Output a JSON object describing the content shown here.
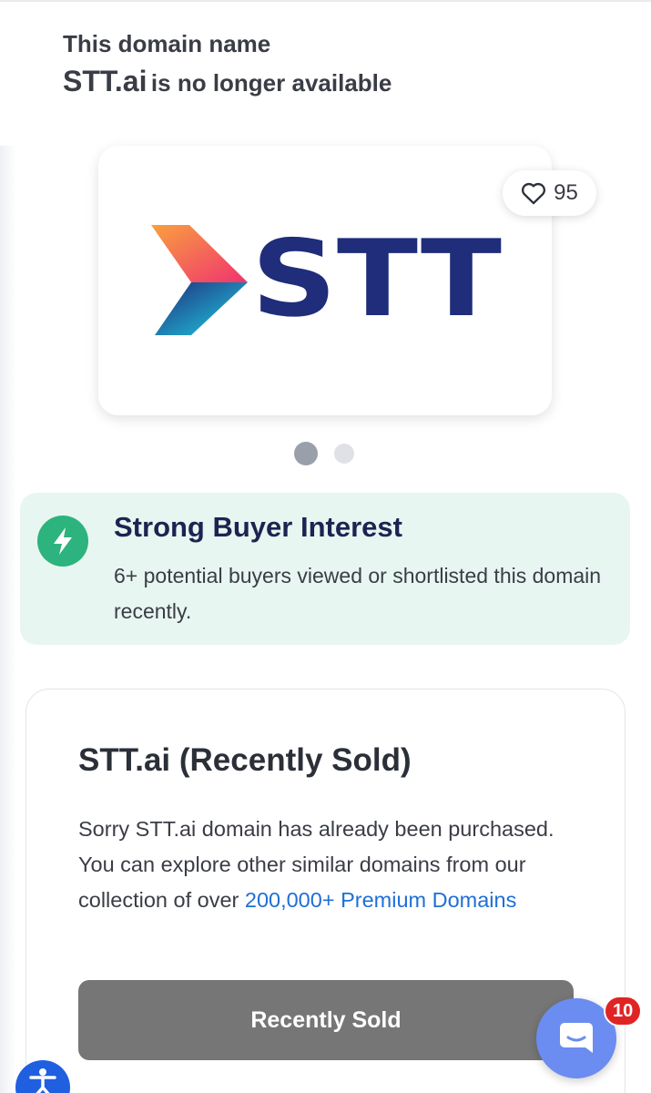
{
  "heading": {
    "line1": "This domain name",
    "domain": "STT.ai",
    "status": "is no longer available"
  },
  "logo": {
    "text": "STT"
  },
  "favorite": {
    "icon": "heart-outline-icon",
    "count": "95"
  },
  "carousel": {
    "total": 2,
    "active": 1
  },
  "interest": {
    "icon": "lightning-bolt-icon",
    "title": "Strong Buyer Interest",
    "description": "6+ potential buyers viewed or shortlisted this domain recently."
  },
  "sold": {
    "title": "STT.ai (Recently Sold)",
    "text_before": "Sorry STT.ai domain has already been purchased. You can explore other similar domains from our collection of over ",
    "link": "200,000+ Premium Domains",
    "button": "Recently Sold"
  },
  "chat": {
    "icon": "chat-bubble-icon",
    "badge": "10"
  },
  "accessibility": {
    "icon": "accessibility-icon"
  },
  "colors": {
    "accent_green": "#2db37d",
    "interest_bg": "#e8f6f1",
    "link_blue": "#1f6fd6",
    "logo_navy": "#1f2d7a",
    "sold_button": "#767676",
    "chat_blue": "#6b8cf0",
    "badge_red": "#e02424"
  }
}
